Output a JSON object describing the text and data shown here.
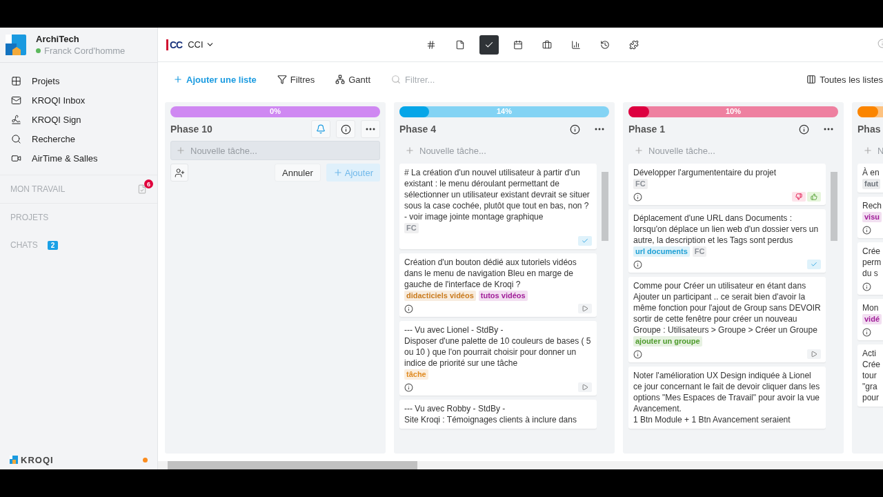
{
  "sidebar": {
    "workspace": "ArchiTech",
    "user": "Franck Cord'homme",
    "online": true,
    "nav": [
      {
        "label": "Projets",
        "kind": "grid"
      },
      {
        "label": "KROQI Inbox",
        "kind": "mail"
      },
      {
        "label": "KROQI Sign",
        "kind": "sign"
      },
      {
        "label": "Recherche",
        "kind": "search"
      },
      {
        "label": "AirTime & Salles",
        "kind": "video"
      }
    ],
    "sections": [
      {
        "label": "MON TRAVAIL",
        "badge": "6",
        "kind": "work"
      },
      {
        "label": "PROJETS",
        "kind": "plain"
      },
      {
        "label": "CHATS",
        "badge": "2",
        "kind": "chats"
      }
    ],
    "footer": {
      "logo": "KROQI",
      "color": "#fb8c1e"
    }
  },
  "header": {
    "logo": "CC",
    "project": "CCI",
    "tabs": [
      {
        "kind": "hash",
        "selected": false
      },
      {
        "kind": "file",
        "selected": false
      },
      {
        "kind": "check",
        "selected": true
      },
      {
        "kind": "calendar",
        "selected": false
      },
      {
        "kind": "briefcase",
        "selected": false
      },
      {
        "kind": "chart",
        "selected": false
      },
      {
        "kind": "history",
        "selected": false
      },
      {
        "kind": "puzzle",
        "selected": false
      }
    ]
  },
  "toolbar": {
    "add_list": "Ajouter une liste",
    "filters": "Filtres",
    "gantt": "Gantt",
    "search_placeholder": "Filtrer...",
    "all_lists": "Toutes les listes"
  },
  "columns": [
    {
      "title": "Phase 10",
      "progress": {
        "label": "0%",
        "level": 0
      },
      "color": "#cf88f2",
      "actions": true,
      "notifications": true,
      "editing": true,
      "new_task": {
        "placeholder": "Nouvelle tâche...",
        "cancel": "Annuler",
        "add": "Ajouter"
      }
    },
    {
      "title": "Phase 4",
      "progress": {
        "label": "14%",
        "level": 0.14
      },
      "color": "#06a6e8",
      "actions": true,
      "notifications": false,
      "editing": false,
      "new_task": {
        "placeholder": "Nouvelle tâche..."
      },
      "cards": [
        {
          "text": "# La création d'un nouvel utilisateur à partir d'un existant : le menu déroulant permettant de sélectionner un utilisateur existant devrait se situer sous la case cochée, plutôt que tout en bas, non ? - voir image jointe montage graphique",
          "tags": [
            {
              "label": "FC",
              "color": "#8a8f96"
            }
          ],
          "info": false,
          "kind": "check"
        },
        {
          "text": "Création d'un bouton dédié aux tutoriels vidéos dans le menu de navigation Bleu en marge de gauche de l'interface de Kroqi ?",
          "tags": [
            {
              "label": "didacticiels vidéos",
              "color": "#c97a1c"
            },
            {
              "label": "tutos vidéos",
              "color": "#a01c98"
            }
          ],
          "info": true,
          "kind": "play"
        },
        {
          "text": "--- Vu avec Lionel - StdBy -\nDisposer d'une palette de 10 couleurs de bases ( 5 ou 10 ) que l'on pourrait choisir pour donner un indice de priorité sur une tâche",
          "tags": [
            {
              "label": "tâche",
              "color": "#e08a20"
            }
          ],
          "info": true,
          "kind": "play"
        },
        {
          "text": "--- Vu avec Robby - StdBy -\nSite Kroqi : Témoignages clients à inclure dans",
          "info": false
        }
      ]
    },
    {
      "title": "Phase 1",
      "progress": {
        "label": "10%",
        "level": 0.1
      },
      "color": "#dd0040",
      "actions": true,
      "notifications": false,
      "editing": false,
      "new_task": {
        "placeholder": "Nouvelle tâche..."
      },
      "cards": [
        {
          "text": "Développer l'argumententaire du projet",
          "tags": [
            {
              "label": "FC",
              "color": "#8a8f96"
            }
          ],
          "info": true,
          "kind": "votes"
        },
        {
          "text": "Déplacement d'une URL dans Documents : lorsqu'on déplace un lien web d'un dossier vers un autre, la description et les Tags sont perdus",
          "tags": [
            {
              "label": "url documents",
              "color": "#1d9fd4"
            },
            {
              "label": "FC",
              "color": "#8a8f96"
            }
          ],
          "info": true,
          "kind": "check"
        },
        {
          "text": "Comme pour Créer un utilisateur en étant dans Ajouter un participant .. ce serait bien d'avoir la même fonction pour l'ajout de Group sans DEVOIR sortir de cette fenêtre pour créer un nouveau Groupe : Utilisateurs > Groupe > Créer un Groupe",
          "tags": [
            {
              "label": "ajouter un groupe",
              "color": "#4c9a2a"
            }
          ],
          "info": true,
          "kind": "play"
        },
        {
          "text": "Noter l'amélioration UX Design indiquée à Lionel ce jour concernant le fait de devoir cliquer dans les options \"Mes Espaces de Travail\" pour avoir la vue Avancement.\n1 Btn Module + 1 Btn Avancement seraient",
          "info": false
        }
      ]
    },
    {
      "title": "Phas",
      "progress": {
        "level": 0.1
      },
      "color": "#fb8500",
      "notifications": false,
      "editing": false,
      "new_task": {
        "placeholder": "N"
      },
      "cards": [
        {
          "text": "À en",
          "tags": [
            {
              "label": "faut",
              "color": "#6f757c"
            }
          ],
          "info": false
        },
        {
          "text": "Rech",
          "tags": [
            {
              "label": "visu",
              "color": "#a01c98"
            }
          ],
          "info": true
        },
        {
          "text": "Crée\nperm\ndu s",
          "info": true
        },
        {
          "text": "Mon",
          "tags": [
            {
              "label": "vidé",
              "color": "#a01c98"
            }
          ],
          "info": true
        },
        {
          "text": "Acti\nCrée\ntour\n\"gra\npour",
          "info": false
        }
      ]
    }
  ]
}
